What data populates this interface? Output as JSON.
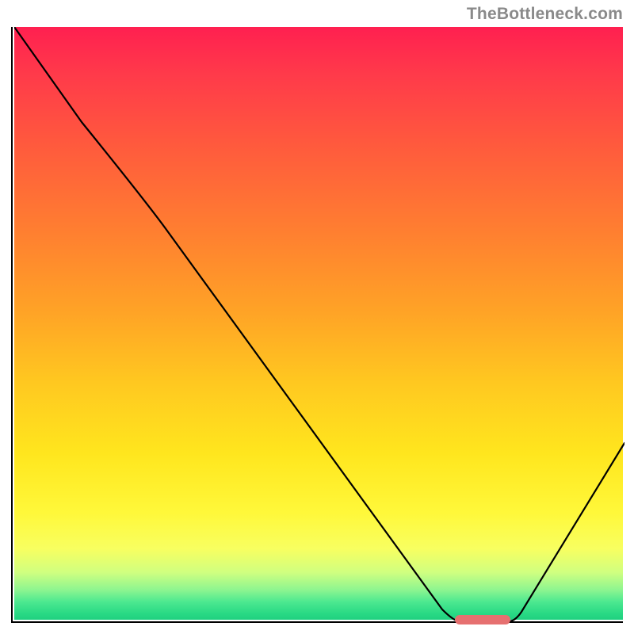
{
  "watermark": "TheBottleneck.com",
  "colors": {
    "axis": "#000000",
    "curve": "#000000",
    "marker": "#e67070",
    "gradient_top": "#ff2050",
    "gradient_bottom": "#20d080"
  },
  "chart_data": {
    "type": "line",
    "title": "",
    "xlabel": "",
    "ylabel": "",
    "xlim": [
      0,
      100
    ],
    "ylim": [
      0,
      100
    ],
    "x": [
      0,
      11,
      25,
      70,
      73,
      81,
      100
    ],
    "values": [
      100,
      84,
      72,
      2,
      0,
      0,
      30
    ],
    "marker": {
      "x_start": 73,
      "x_end": 81,
      "y": 0
    },
    "notes": "Values are relative percentages read from a bottleneck-style plot. The curve descends from top-left, with a slight slope change around x≈25, reaches a flat minimum between roughly x≈73 and x≈81 (highlighted by the rounded marker at the baseline), then rises toward the right edge. Background is a vertical red→yellow→green gradient."
  }
}
